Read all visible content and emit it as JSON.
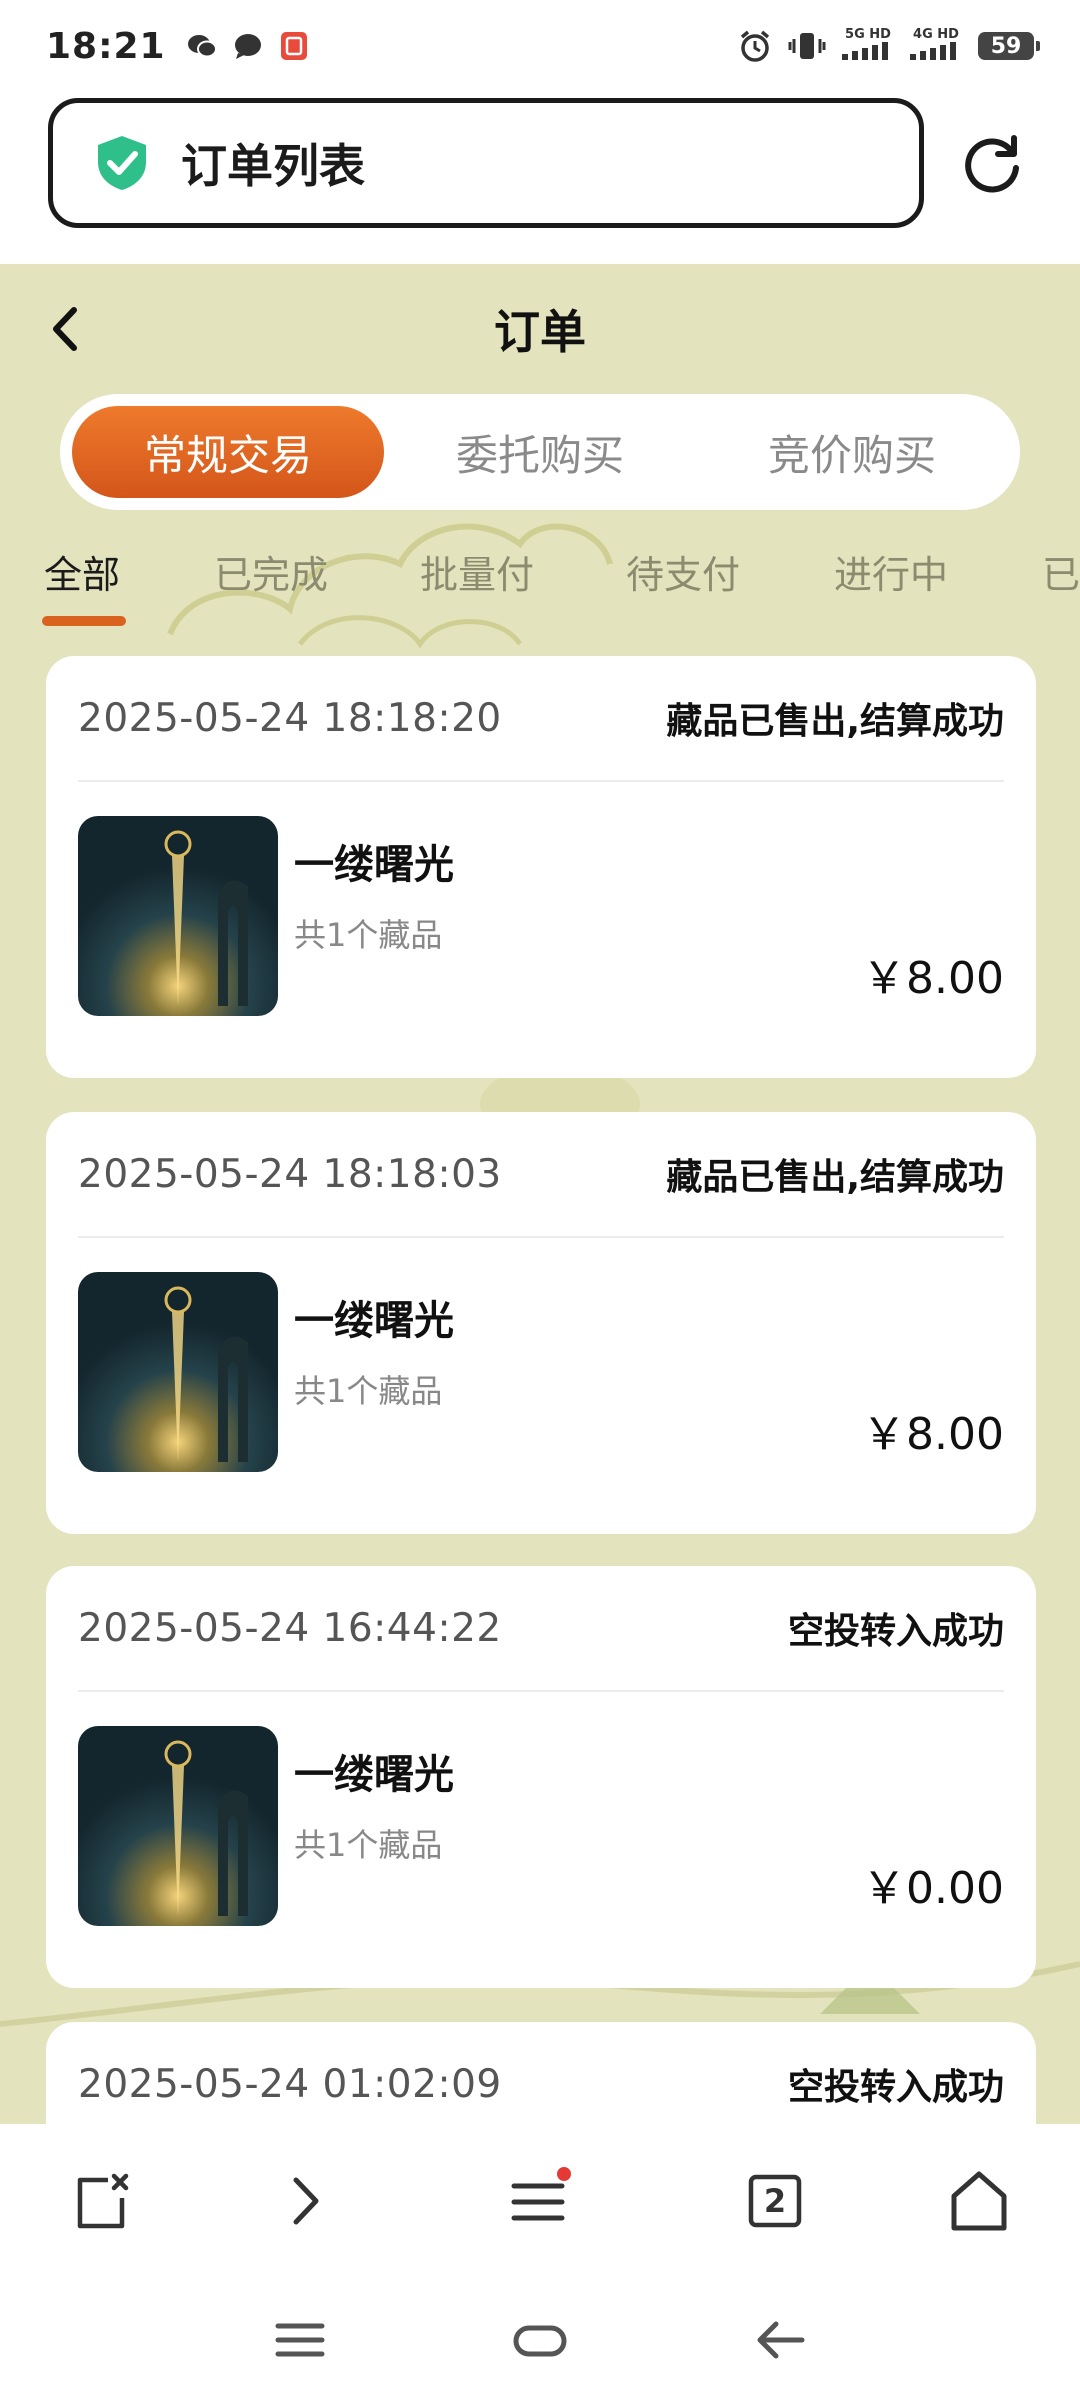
{
  "status_bar": {
    "time": "18:21",
    "network_1": "5G HD",
    "network_2": "4G HD",
    "battery": "59"
  },
  "browser": {
    "address_text": "订单列表",
    "tab_count": "2"
  },
  "header": {
    "title": "订单"
  },
  "segments": [
    {
      "label": "常规交易",
      "active": true
    },
    {
      "label": "委托购买",
      "active": false
    },
    {
      "label": "竞价购买",
      "active": false
    }
  ],
  "filter_tabs": [
    {
      "label": "全部",
      "active": true
    },
    {
      "label": "已完成",
      "active": false
    },
    {
      "label": "批量付",
      "active": false
    },
    {
      "label": "待支付",
      "active": false
    },
    {
      "label": "进行中",
      "active": false
    },
    {
      "label": "已",
      "active": false
    }
  ],
  "orders": [
    {
      "time": "2025-05-24 18:18:20",
      "status": "藏品已售出,结算成功",
      "name": "一缕曙光",
      "count": "共1个藏品",
      "price": "￥8.00"
    },
    {
      "time": "2025-05-24 18:18:03",
      "status": "藏品已售出,结算成功",
      "name": "一缕曙光",
      "count": "共1个藏品",
      "price": "￥8.00"
    },
    {
      "time": "2025-05-24 16:44:22",
      "status": "空投转入成功",
      "name": "一缕曙光",
      "count": "共1个藏品",
      "price": "￥0.00"
    },
    {
      "time": "2025-05-24 01:02:09",
      "status": "空投转入成功",
      "name": "",
      "count": "",
      "price": ""
    }
  ],
  "colors": {
    "accent": "#d9621f",
    "page_background": "#e3e3bd",
    "shield": "#2fbf8a",
    "notification_dot": "#e53935"
  },
  "icons": {
    "back": "chevron-left-icon",
    "refresh": "refresh-icon",
    "shield": "shield-check-icon",
    "toolbar": [
      "close-tab-icon",
      "forward-icon",
      "menu-icon",
      "tabs-icon",
      "home-icon"
    ],
    "system_nav": [
      "recent-apps-icon",
      "home-pill-icon",
      "back-arrow-icon"
    ]
  }
}
